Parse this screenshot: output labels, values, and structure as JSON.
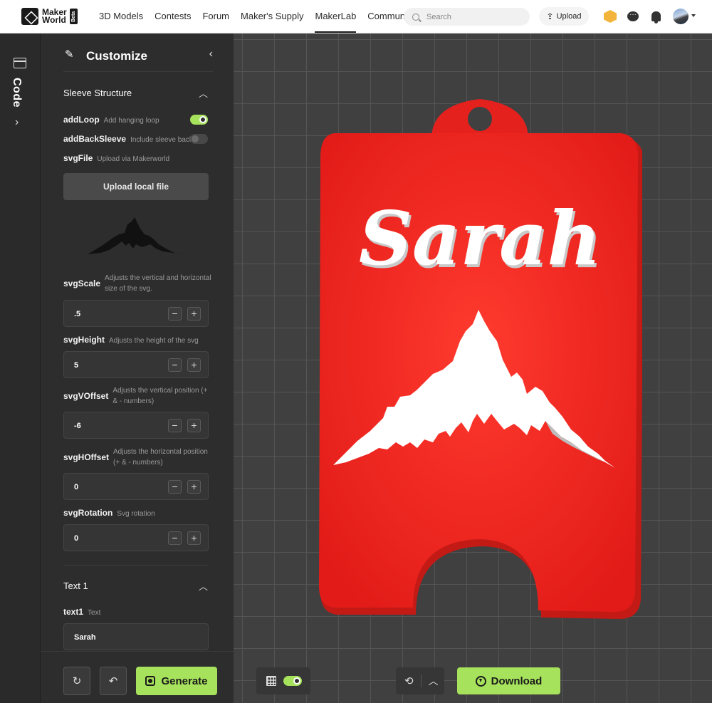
{
  "brand": {
    "line1": "Maker",
    "line2": "World",
    "badge": "Beta"
  },
  "nav": {
    "links": [
      "3D Models",
      "Contests",
      "Forum",
      "Maker's Supply",
      "MakerLab",
      "Community"
    ],
    "active": "MakerLab",
    "search_placeholder": "Search",
    "upload_label": "Upload"
  },
  "rail": {
    "label": "Code"
  },
  "panel": {
    "title": "Customize",
    "sections": {
      "sleeve": {
        "title": "Sleeve Structure"
      },
      "text1": {
        "title": "Text 1"
      }
    },
    "params": {
      "addLoop": {
        "name": "addLoop",
        "desc": "Add hanging loop",
        "value": true
      },
      "addBackSleeve": {
        "name": "addBackSleeve",
        "desc": "Include sleeve back",
        "value": false
      },
      "svgFile": {
        "name": "svgFile",
        "desc": "Upload via Makerworld",
        "button": "Upload local file"
      },
      "svgScale": {
        "name": "svgScale",
        "desc": "Adjusts the vertical and horizontal size of the svg.",
        "value": ".5"
      },
      "svgHeight": {
        "name": "svgHeight",
        "desc": "Adjusts the height of the svg",
        "value": "5"
      },
      "svgVOffset": {
        "name": "svgVOffset",
        "desc": "Adjusts the vertical position (+ & - numbers)",
        "value": "-6"
      },
      "svgHOffset": {
        "name": "svgHOffset",
        "desc": "Adjusts the horizontal position (+ & - numbers)",
        "value": "0"
      },
      "svgRotation": {
        "name": "svgRotation",
        "desc": "Svg rotation",
        "value": "0"
      },
      "text1": {
        "name": "text1",
        "desc": "Text",
        "value": "Sarah"
      }
    },
    "stepper": {
      "minus": "−",
      "plus": "+"
    },
    "footer": {
      "generate_label": "Generate"
    }
  },
  "viewport": {
    "model_text": "Sarah",
    "model_color": "#e8231f",
    "grid_toggle": true,
    "download_label": "Download"
  },
  "colors": {
    "accent": "#a6e25c",
    "panel_bg": "#2d2d2d",
    "viewport_bg": "#404040"
  },
  "icons": [
    "wand-icon",
    "chevron-left-icon",
    "chevron-up-icon",
    "search-icon",
    "upload-icon",
    "cube-icon",
    "chat-icon",
    "bell-icon",
    "code-icon",
    "refresh-icon",
    "undo-icon",
    "generate-icon",
    "grid-icon",
    "history-icon",
    "download-icon"
  ]
}
